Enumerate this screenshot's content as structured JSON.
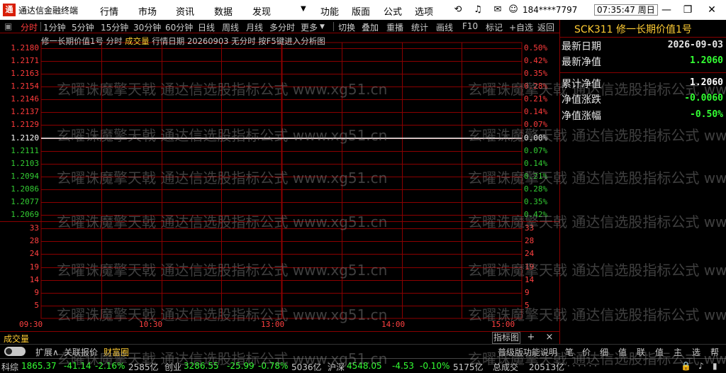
{
  "window": {
    "logo": "通",
    "app_name": "通达信金融终端",
    "menus": [
      "行情",
      "市场",
      "资讯",
      "数据",
      "发现",
      "功能",
      "版面",
      "公式",
      "选项"
    ],
    "user": "184****7797",
    "time": "07:35:47 周日"
  },
  "toolbar": {
    "items": [
      "分时",
      "1分钟",
      "5分钟",
      "15分钟",
      "30分钟",
      "60分钟",
      "日线",
      "周线",
      "月线",
      "多分时",
      "更多",
      "切换",
      "叠加",
      "重播",
      "统计",
      "画线",
      "F10",
      "标记",
      "+自选",
      "返回"
    ],
    "active_index": 0
  },
  "chart": {
    "title_name": "修一长期价值1号",
    "title_mode": "分时",
    "title_vol": "成交量",
    "title_rest": "行情日期 20260903 无分时 按F5键进入分析图"
  },
  "chart_data": {
    "type": "line",
    "price_axis": {
      "labels": [
        "1.2180",
        "1.2171",
        "1.2163",
        "1.2154",
        "1.2146",
        "1.2137",
        "1.2129",
        "1.2120",
        "1.2111",
        "1.2103",
        "1.2094",
        "1.2086",
        "1.2077",
        "1.2069"
      ],
      "base": "1.2120",
      "ylim": [
        1.2069,
        1.218
      ]
    },
    "pct_axis": {
      "labels": [
        "0.50%",
        "0.42%",
        "0.35%",
        "0.28%",
        "0.21%",
        "0.14%",
        "0.07%",
        "0.00%",
        "0.07%",
        "0.14%",
        "0.21%",
        "0.28%",
        "0.35%",
        "0.42%"
      ]
    },
    "volume_axis": {
      "labels": [
        "33",
        "28",
        "24",
        "19",
        "14",
        "9",
        "5"
      ]
    },
    "time_axis": {
      "labels": [
        "09:30",
        "10:30",
        "13:00",
        "14:00",
        "15:00"
      ]
    },
    "series": [
      {
        "values": [
          1.212,
          1.212
        ]
      }
    ],
    "grid": true,
    "colors": {
      "up": "#ff3b3b",
      "down": "#33cc33",
      "neutral": "#ffffff",
      "grid": "#8b0000"
    }
  },
  "volume_panel": {
    "label": "成交量",
    "indicator_button": "指标图",
    "add_button": "+",
    "close_button": "×"
  },
  "bottom_tabs": {
    "items": [
      "扩展∧",
      "关联报价",
      "财富圈",
      "普级版功能说明"
    ],
    "highlight_index": 2,
    "right_items": [
      "笔",
      "价",
      "细",
      "值",
      "联",
      "值",
      "主",
      "选",
      "帮"
    ]
  },
  "status": {
    "entries": [
      {
        "name": "科综",
        "value": "1865.37",
        "chg": "-41.14",
        "pct": "-2.16%",
        "amt": "2585亿"
      },
      {
        "name": "创业",
        "value": "3286.55",
        "chg": "-25.99",
        "pct": "-0.78%",
        "amt": "5036亿"
      },
      {
        "name": "沪深",
        "value": "4548.05",
        "chg": "-4.53",
        "pct": "-0.10%",
        "amt": "5175亿"
      }
    ],
    "total_label": "总成交",
    "total_value": "20513亿"
  },
  "side_panel": {
    "title": "SCK311  修一长期价值1号",
    "rows": [
      {
        "label": "最新日期",
        "value": "2026-09-03",
        "color": "#e8e8e8"
      },
      {
        "label": "最新净值",
        "value": "1.2060",
        "color": "#33ff33"
      },
      {
        "label": "累计净值",
        "value": "1.2060",
        "color": "#ffffff"
      },
      {
        "label": "净值涨跌",
        "value": "-0.0060",
        "color": "#33ff33"
      },
      {
        "label": "净值涨幅",
        "value": "-0.50%",
        "color": "#33ff33"
      }
    ]
  },
  "watermark": {
    "text_a": "玄曜诛魔擎天戟",
    "text_b": "通达信选股指标公式",
    "text_c": "www.xg51.cn",
    "color": "#969696"
  }
}
